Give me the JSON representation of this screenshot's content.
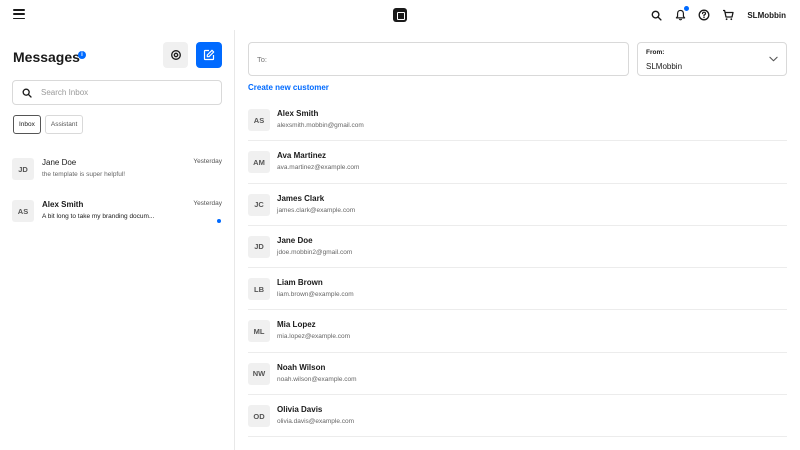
{
  "topbar": {
    "username": "SLMobbin",
    "icons": [
      "menu-icon",
      "square-logo-icon",
      "search-icon",
      "bell-icon",
      "help-icon",
      "cart-icon"
    ]
  },
  "sidebar": {
    "title": "Messages",
    "info_badge": "i",
    "search": {
      "placeholder": "Search Inbox",
      "value": ""
    },
    "tabs": [
      {
        "label": "Inbox",
        "active": true
      },
      {
        "label": "Assistant",
        "active": false
      }
    ],
    "conversations": [
      {
        "initials": "JD",
        "name": "Jane Doe",
        "preview": "the template is super helpful!",
        "time": "Yesterday",
        "unread": false
      },
      {
        "initials": "AS",
        "name": "Alex Smith",
        "preview": "A bit long to take my branding docum...",
        "time": "Yesterday",
        "unread": true
      }
    ]
  },
  "compose": {
    "to_label": "To:",
    "to_value": "",
    "from_label": "From:",
    "from_value": "SLMobbin",
    "create_link": "Create new customer"
  },
  "customers": [
    {
      "initials": "AS",
      "name": "Alex Smith",
      "email": "alexsmith.mobbin@gmail.com"
    },
    {
      "initials": "AM",
      "name": "Ava Martinez",
      "email": "ava.martinez@example.com"
    },
    {
      "initials": "JC",
      "name": "James Clark",
      "email": "james.clark@example.com"
    },
    {
      "initials": "JD",
      "name": "Jane Doe",
      "email": "jdoe.mobbin2@gmail.com"
    },
    {
      "initials": "LB",
      "name": "Liam Brown",
      "email": "liam.brown@example.com"
    },
    {
      "initials": "ML",
      "name": "Mia Lopez",
      "email": "mia.lopez@example.com"
    },
    {
      "initials": "NW",
      "name": "Noah Wilson",
      "email": "noah.wilson@example.com"
    },
    {
      "initials": "OD",
      "name": "Olivia Davis",
      "email": "olivia.davis@example.com"
    }
  ],
  "colors": {
    "accent": "#006aff",
    "avatar_bg": "#f0f0f0",
    "border": "#d9d9d9"
  }
}
